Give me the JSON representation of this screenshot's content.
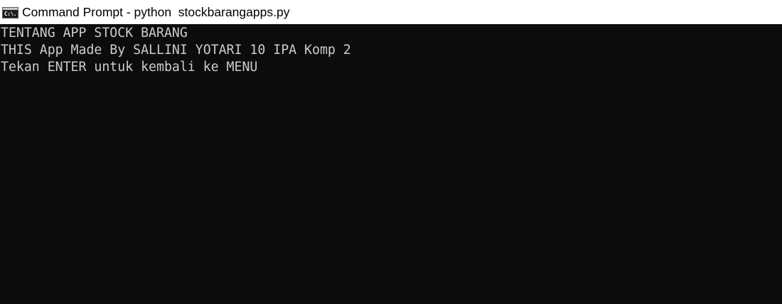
{
  "window": {
    "icon": "command-prompt-icon",
    "icon_glyph": "C:\\.",
    "title": "Command Prompt - python  stockbarangapps.py"
  },
  "console": {
    "background": "#0c0c0c",
    "foreground": "#cccccc",
    "lines": [
      "TENTANG APP STOCK BARANG",
      "THIS App Made By SALLINI YOTARI 10 IPA Komp 2",
      "Tekan ENTER untuk kembali ke MENU"
    ]
  }
}
